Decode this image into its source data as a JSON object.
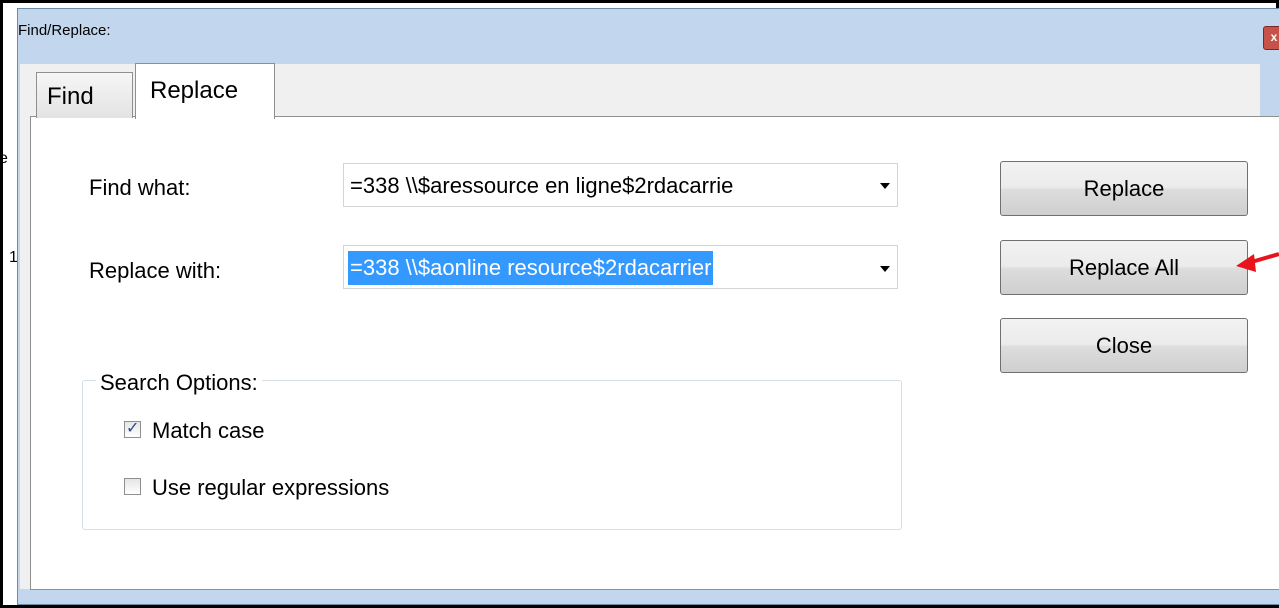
{
  "window": {
    "title": "Find/Replace:",
    "close_glyph": "x"
  },
  "tabs": [
    {
      "label": "Find",
      "active": false
    },
    {
      "label": "Replace",
      "active": true
    }
  ],
  "fields": {
    "find_label": "Find what:",
    "find_value": "=338  \\\\$aressource en ligne$2rdacarrie",
    "replace_label": "Replace with:",
    "replace_value": "=338  \\\\$aonline resource$2rdacarrier"
  },
  "buttons": {
    "replace": "Replace",
    "replace_all": "Replace All",
    "close": "Close"
  },
  "search_options": {
    "legend": "Search Options:",
    "match_case": {
      "label": "Match case",
      "checked": true
    },
    "regex": {
      "label": "Use regular expressions",
      "checked": false
    }
  },
  "annotation": {
    "arrow_color": "#e8141b",
    "points_to": "replace_all"
  },
  "edge_fragments": [
    "e",
    "1"
  ],
  "colors": {
    "selection": "#3399ff",
    "title_bar": "#c2d7ed",
    "close_button": "#c7524a"
  }
}
